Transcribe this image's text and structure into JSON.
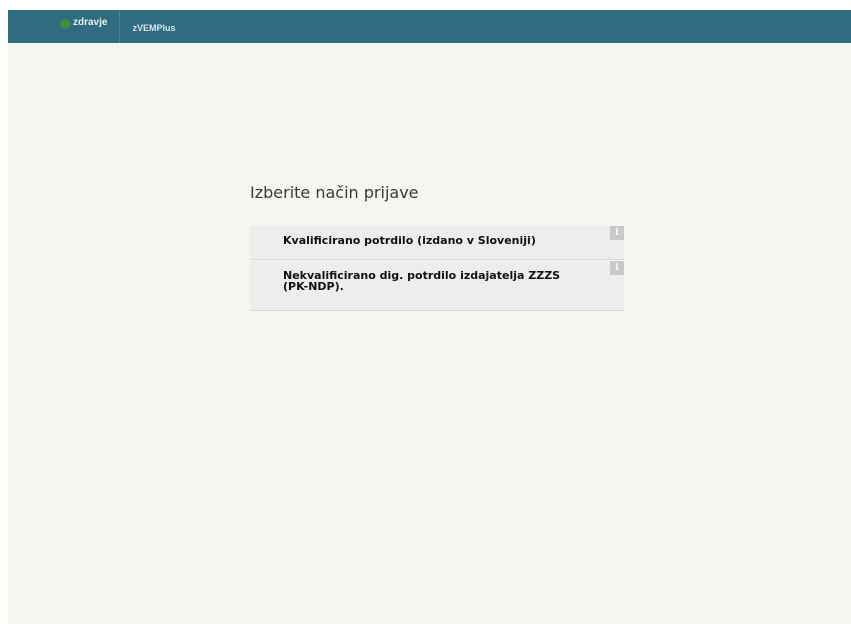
{
  "header": {
    "brand_name": "zdravje",
    "brand_icon": "leaf-logo-icon",
    "app_name": "zVEMPlus",
    "bar_color": "#2f6c82"
  },
  "login": {
    "heading": "Izberite način prijave",
    "options": [
      {
        "label": "Kvalificirano potrdilo (izdano v Sloveniji)",
        "info_icon": "i"
      },
      {
        "label": "Nekvalificirano dig. potrdilo izdajatelja ZZZS (PK-NDP).",
        "info_icon": "i"
      }
    ]
  }
}
